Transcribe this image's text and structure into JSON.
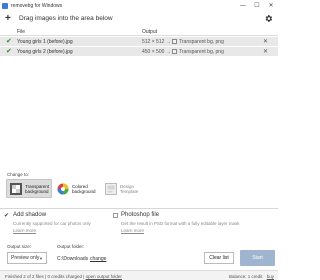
{
  "window": {
    "title": "removebg for Windows",
    "controls": [
      "—",
      "☐",
      "✕"
    ]
  },
  "toolbar": {
    "add_icon": "plus-icon",
    "drag_hint": "Drag images into the area below",
    "settings_icon": "gear-icon"
  },
  "table": {
    "headers": {
      "file": "File",
      "output": "Output"
    },
    "rows": [
      {
        "status_icon": "check-icon",
        "file": "Young girls 1 (before).jpg",
        "size": "512 × 512",
        "arrow": "→",
        "result": "Transparent bg, png",
        "remove": "✕"
      },
      {
        "status_icon": "check-icon",
        "file": "Young girls 2 (before).jpg",
        "size": "450 × 500",
        "arrow": "→",
        "result": "Transparent bg, png",
        "remove": "✕"
      }
    ]
  },
  "change_to": {
    "label": "Change to:",
    "options": [
      {
        "line1": "Transparent",
        "line2": "background",
        "selected": true
      },
      {
        "line1": "Colored",
        "line2": "background",
        "selected": false
      },
      {
        "line1": "Design",
        "line2": "Template",
        "selected": false
      }
    ]
  },
  "options": {
    "add_shadow": {
      "label": "Add shadow",
      "desc": "Currently supported for car photos only",
      "learn_more": "Learn more",
      "checked": true
    },
    "photoshop_file": {
      "label": "Photoshop file",
      "desc": "Get the result in PSD format with a fully editable layer mask",
      "learn_more": "Learn more",
      "checked": false
    }
  },
  "output_size": {
    "label": "Output size:",
    "value": "Preview only"
  },
  "output_folder": {
    "label": "Output folder:",
    "path": "C:\\Downloads",
    "change": "change"
  },
  "buttons": {
    "clear": "Clear list",
    "start": "Start"
  },
  "status": {
    "summary": "Finished 2 of 2 files | 0 credits charged |",
    "open_folder": "open output folder",
    "balance": "Balance: 1 credit",
    "buy": "buy"
  },
  "colors": {
    "accent_check": "#2e8b2e",
    "start_button": "#9fb5cf",
    "selected_row": "#e8e8e8"
  }
}
